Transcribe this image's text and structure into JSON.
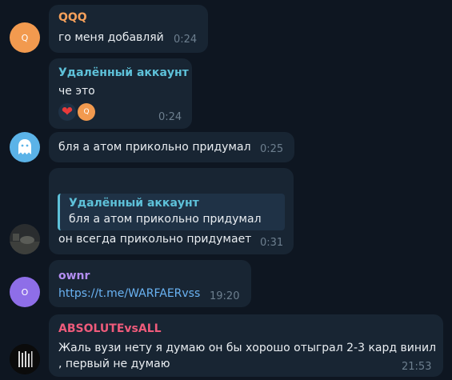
{
  "messages": [
    {
      "sender": "QQQ",
      "sender_color": "#f5a05b",
      "avatar_letter": "Q",
      "avatar_color": "#f29a4f",
      "text": "го меня добавляй",
      "time": "0:24"
    },
    {
      "sender": "Удалённый аккаунт",
      "sender_color": "#5ec1d9",
      "text": "че это",
      "time": "0:24",
      "reactions": [
        {
          "icon": "heart-icon",
          "color": "#e83a3a"
        },
        {
          "avatar_letter": "Q",
          "color": "#f29a4f"
        }
      ]
    },
    {
      "avatar_icon": "ghost-icon",
      "avatar_color": "#5bb3e8",
      "text": "бля а атом прикольно придумал",
      "time": "0:25"
    },
    {
      "quote": {
        "sender": "Удалённый аккаунт",
        "text": "бля а атом прикольно придумал"
      },
      "text": "он всегда прикольно придумает",
      "time": "0:31"
    },
    {
      "sender": "ownr",
      "sender_color": "#b38ef2",
      "avatar_letter": "O",
      "avatar_color": "#8e6ee8",
      "text": "https://t.me/WARFAERvss",
      "time": "19:20"
    },
    {
      "sender": "ABSOLUTEvsALL",
      "sender_color": "#ef5b7b",
      "text_line1": "Жаль вузи нету я думаю он бы хорошо отыграл 2-3 кард винил",
      "text_line2": ", первый не думаю",
      "time": "21:53"
    }
  ]
}
